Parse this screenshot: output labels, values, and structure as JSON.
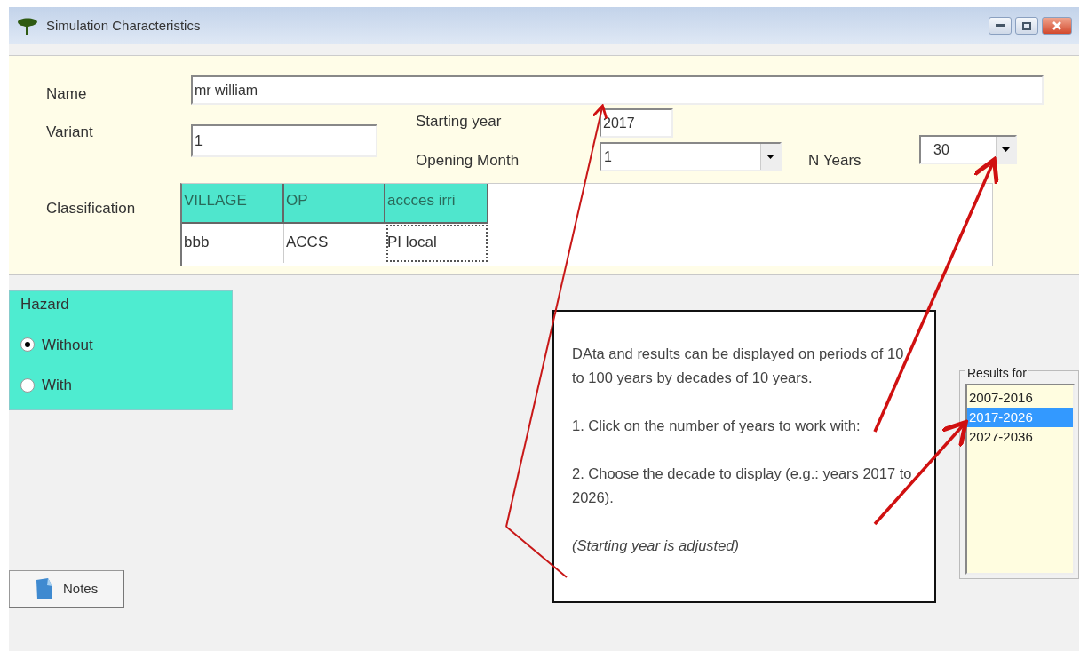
{
  "window": {
    "title": "Simulation Characteristics"
  },
  "form": {
    "name_label": "Name",
    "name_value": "mr william",
    "variant_label": "Variant",
    "variant_value": "1",
    "starting_year_label": "Starting year",
    "starting_year_value": "2017",
    "opening_month_label": "Opening Month",
    "opening_month_value": "1",
    "n_years_label": "N Years",
    "n_years_value": "30"
  },
  "classification": {
    "label": "Classification",
    "columns": [
      "VILLAGE",
      "OP",
      "accces irri"
    ],
    "rows": [
      [
        {
          "text": "bbb",
          "focused": false
        },
        {
          "text": "ACCS",
          "focused": false
        },
        {
          "text": "PI local",
          "focused": true
        }
      ]
    ]
  },
  "hazard": {
    "title": "Hazard",
    "options": [
      {
        "label": "Without",
        "selected": true
      },
      {
        "label": "With",
        "selected": false
      }
    ]
  },
  "notes_button": {
    "label": "Notes"
  },
  "callout": {
    "paragraphs": [
      "DAta and results can be displayed on periods of 10 to 100 years by decades of 10 years.",
      "1. Click on the number of years to work with:",
      "2. Choose the decade to display (e.g.: years 2017 to 2026)."
    ],
    "note": "(Starting year is adjusted)"
  },
  "results": {
    "title": "Results for",
    "items": [
      {
        "label": "2007-2016",
        "selected": false
      },
      {
        "label": "2017-2026",
        "selected": true
      },
      {
        "label": "2027-2036",
        "selected": false
      }
    ]
  }
}
